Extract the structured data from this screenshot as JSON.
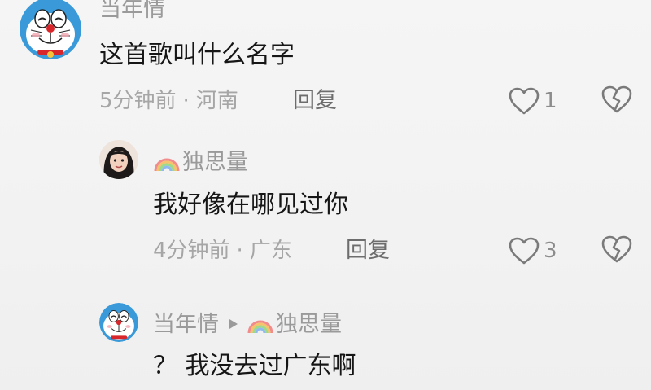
{
  "comments": [
    {
      "username": "当年情",
      "text": "这首歌叫什么名字",
      "time": "5分钟前",
      "separator": "·",
      "location": "河南",
      "reply_label": "回复",
      "like_count": "1",
      "avatar_icon": "doraemon-avatar"
    },
    {
      "username": "独思量",
      "text": "我好像在哪见过你",
      "time": "4分钟前",
      "separator": "·",
      "location": "广东",
      "reply_label": "回复",
      "like_count": "3",
      "avatar_icon": "girl-avatar",
      "name_icon": "rainbow-icon"
    },
    {
      "username": "当年情",
      "reply_to": "独思量",
      "text": "？ 我没去过广东啊",
      "avatar_icon": "doraemon-avatar",
      "name_icon": "rainbow-icon"
    }
  ],
  "colors": {
    "background": "#f2f2f2",
    "username": "#9a9a9a",
    "body": "#161616",
    "meta": "#a6a6a6",
    "reply": "#6d6d6d",
    "icon": "#7a7a7a"
  }
}
